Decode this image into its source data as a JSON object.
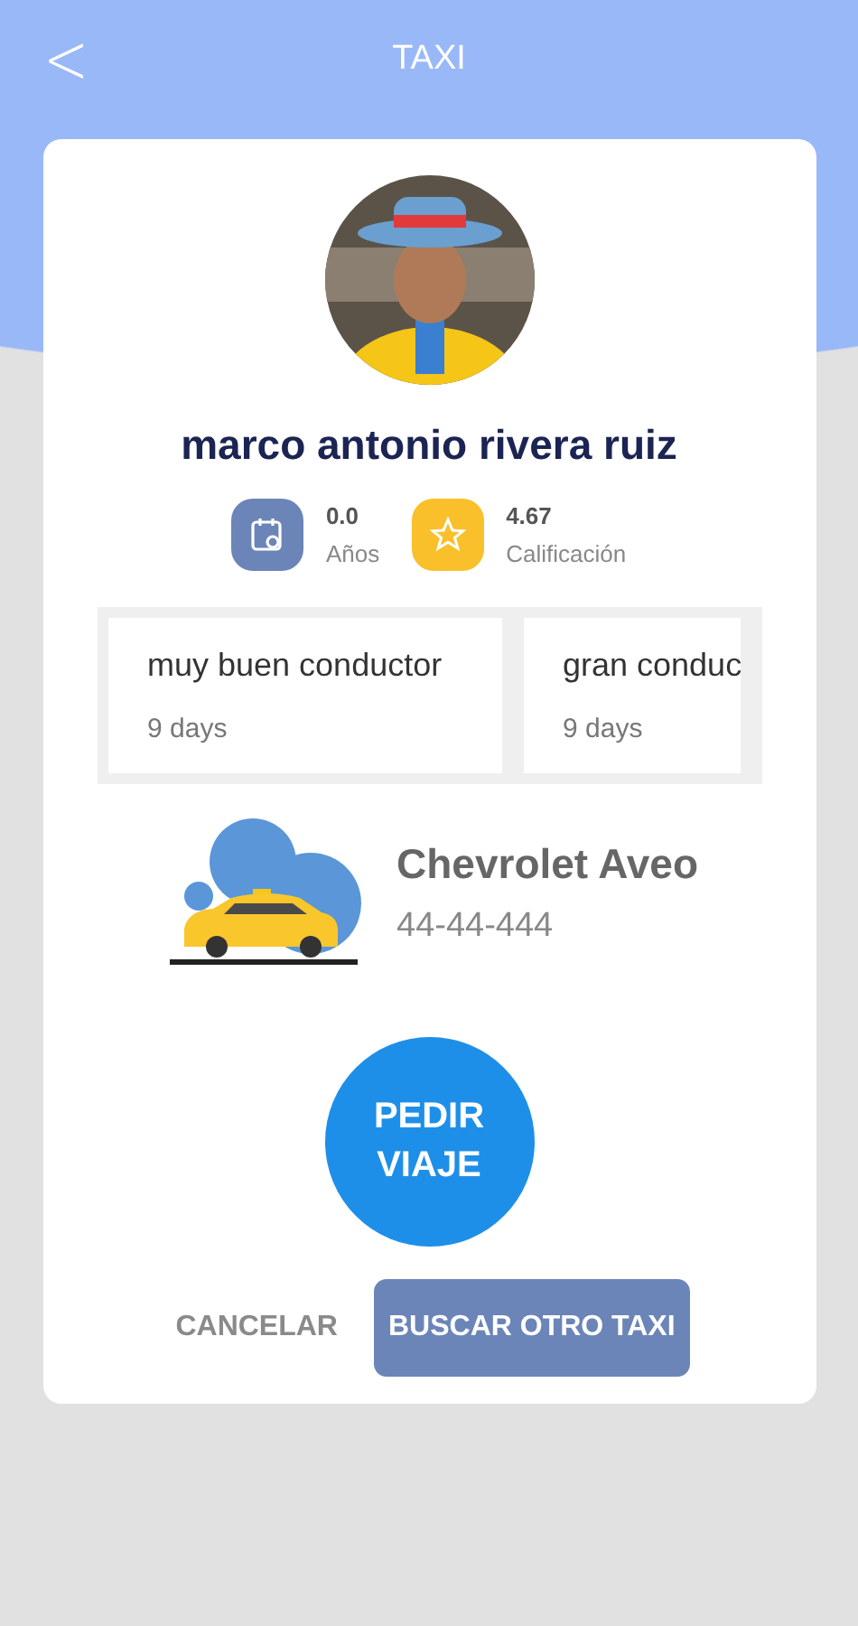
{
  "header": {
    "back_glyph": "<",
    "title": "TAXI"
  },
  "driver": {
    "name": "marco antonio rivera ruiz"
  },
  "stats": [
    {
      "kind": "years",
      "value": "0.0",
      "label": "Años"
    },
    {
      "kind": "rating",
      "value": "4.67",
      "label": "Calificación"
    }
  ],
  "reviews": [
    {
      "text": "muy buen conductor",
      "time": "9 days"
    },
    {
      "text": "gran conduc",
      "time": "9 days"
    }
  ],
  "vehicle": {
    "model": "Chevrolet Aveo",
    "plate": "44-44-444"
  },
  "primary_action": {
    "line_1": "PEDIR",
    "line_2": "VIAJE"
  },
  "actions": [
    {
      "kind": "text",
      "label": "CANCELAR"
    },
    {
      "kind": "filled",
      "label": "BUSCAR OTRO TAXI"
    }
  ]
}
